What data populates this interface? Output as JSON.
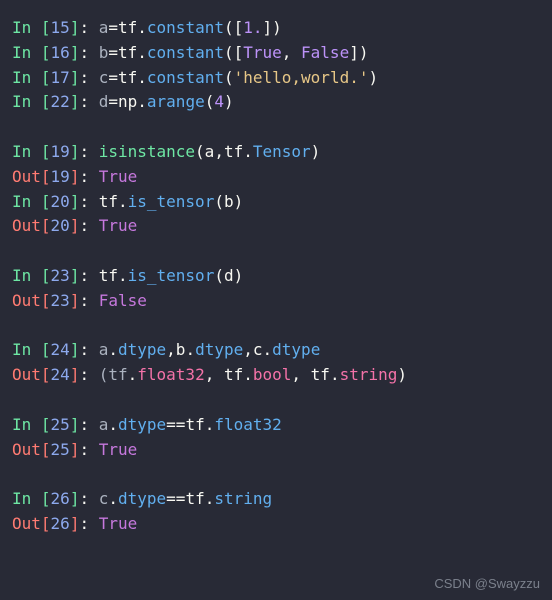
{
  "lines": [
    {
      "type": "in",
      "n": "15",
      "tokens": [
        {
          "c": "id",
          "t": "a"
        },
        {
          "c": "op",
          "t": "="
        },
        {
          "c": "mod",
          "t": "tf"
        },
        {
          "c": "op",
          "t": "."
        },
        {
          "c": "attr",
          "t": "constant"
        },
        {
          "c": "op",
          "t": "(["
        },
        {
          "c": "lit",
          "t": "1."
        },
        {
          "c": "op",
          "t": "])"
        }
      ]
    },
    {
      "type": "in",
      "n": "16",
      "tokens": [
        {
          "c": "id",
          "t": "b"
        },
        {
          "c": "op",
          "t": "="
        },
        {
          "c": "mod",
          "t": "tf"
        },
        {
          "c": "op",
          "t": "."
        },
        {
          "c": "attr",
          "t": "constant"
        },
        {
          "c": "op",
          "t": "(["
        },
        {
          "c": "kw",
          "t": "True"
        },
        {
          "c": "op",
          "t": ", "
        },
        {
          "c": "kw",
          "t": "False"
        },
        {
          "c": "op",
          "t": "])"
        }
      ]
    },
    {
      "type": "in",
      "n": "17",
      "tokens": [
        {
          "c": "id",
          "t": "c"
        },
        {
          "c": "op",
          "t": "="
        },
        {
          "c": "mod",
          "t": "tf"
        },
        {
          "c": "op",
          "t": "."
        },
        {
          "c": "attr",
          "t": "constant"
        },
        {
          "c": "op",
          "t": "("
        },
        {
          "c": "str",
          "t": "'hello,world.'"
        },
        {
          "c": "op",
          "t": ")"
        }
      ]
    },
    {
      "type": "in",
      "n": "22",
      "tokens": [
        {
          "c": "id",
          "t": "d"
        },
        {
          "c": "op",
          "t": "="
        },
        {
          "c": "mod",
          "t": "np"
        },
        {
          "c": "op",
          "t": "."
        },
        {
          "c": "attr",
          "t": "arange"
        },
        {
          "c": "op",
          "t": "("
        },
        {
          "c": "lit",
          "t": "4"
        },
        {
          "c": "op",
          "t": ")"
        }
      ]
    },
    {
      "type": "blank"
    },
    {
      "type": "in",
      "n": "19",
      "tokens": [
        {
          "c": "call",
          "t": "isinstance"
        },
        {
          "c": "op",
          "t": "(a,tf."
        },
        {
          "c": "attr",
          "t": "Tensor"
        },
        {
          "c": "op",
          "t": ")"
        }
      ]
    },
    {
      "type": "out",
      "n": "19",
      "tokens": [
        {
          "c": "result",
          "t": "True"
        }
      ]
    },
    {
      "type": "in",
      "n": "20",
      "tokens": [
        {
          "c": "mod",
          "t": "tf"
        },
        {
          "c": "op",
          "t": "."
        },
        {
          "c": "attr",
          "t": "is_tensor"
        },
        {
          "c": "op",
          "t": "(b)"
        }
      ]
    },
    {
      "type": "out",
      "n": "20",
      "tokens": [
        {
          "c": "result",
          "t": "True"
        }
      ]
    },
    {
      "type": "blank"
    },
    {
      "type": "in",
      "n": "23",
      "tokens": [
        {
          "c": "mod",
          "t": "tf"
        },
        {
          "c": "op",
          "t": "."
        },
        {
          "c": "attr",
          "t": "is_tensor"
        },
        {
          "c": "op",
          "t": "(d)"
        }
      ]
    },
    {
      "type": "out",
      "n": "23",
      "tokens": [
        {
          "c": "result",
          "t": "False"
        }
      ]
    },
    {
      "type": "blank"
    },
    {
      "type": "in",
      "n": "24",
      "tokens": [
        {
          "c": "id",
          "t": "a"
        },
        {
          "c": "op",
          "t": "."
        },
        {
          "c": "attr",
          "t": "dtype"
        },
        {
          "c": "op",
          "t": ",b."
        },
        {
          "c": "attr",
          "t": "dtype"
        },
        {
          "c": "op",
          "t": ",c."
        },
        {
          "c": "attr",
          "t": "dtype"
        }
      ]
    },
    {
      "type": "out",
      "n": "24",
      "tokens": [
        {
          "c": "id",
          "t": "(tf"
        },
        {
          "c": "op",
          "t": "."
        },
        {
          "c": "pink",
          "t": "float32"
        },
        {
          "c": "op",
          "t": ", tf."
        },
        {
          "c": "pink",
          "t": "bool"
        },
        {
          "c": "op",
          "t": ", tf."
        },
        {
          "c": "pink",
          "t": "string"
        },
        {
          "c": "op",
          "t": ")"
        }
      ]
    },
    {
      "type": "blank"
    },
    {
      "type": "in",
      "n": "25",
      "tokens": [
        {
          "c": "id",
          "t": "a"
        },
        {
          "c": "op",
          "t": "."
        },
        {
          "c": "attr",
          "t": "dtype"
        },
        {
          "c": "op",
          "t": "=="
        },
        {
          "c": "mod",
          "t": "tf"
        },
        {
          "c": "op",
          "t": "."
        },
        {
          "c": "attr",
          "t": "float32"
        }
      ]
    },
    {
      "type": "out",
      "n": "25",
      "tokens": [
        {
          "c": "result",
          "t": "True"
        }
      ]
    },
    {
      "type": "blank"
    },
    {
      "type": "in",
      "n": "26",
      "tokens": [
        {
          "c": "id",
          "t": "c"
        },
        {
          "c": "op",
          "t": "."
        },
        {
          "c": "attr",
          "t": "dtype"
        },
        {
          "c": "op",
          "t": "=="
        },
        {
          "c": "mod",
          "t": "tf"
        },
        {
          "c": "op",
          "t": "."
        },
        {
          "c": "attr",
          "t": "string"
        }
      ]
    },
    {
      "type": "out",
      "n": "26",
      "tokens": [
        {
          "c": "result",
          "t": "True"
        }
      ]
    }
  ],
  "labels": {
    "in_prefix": "In ",
    "out_prefix": "Out",
    "colon": ": "
  },
  "watermark": "CSDN @Swayzzu"
}
